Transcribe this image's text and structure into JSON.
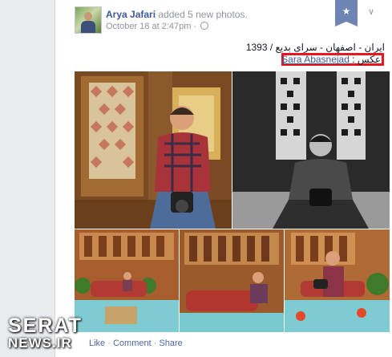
{
  "post": {
    "author": "Arya Jafari",
    "action": " added 5 new photos.",
    "timestamp": "October 18 at 2:47pm",
    "separator": " · ",
    "caption_line1": "ایران - اصفهان - سرای بدیع / 1393",
    "caption_line2_prefix": "عکس : ",
    "caption_line2_name": "Sara Abasnejad"
  },
  "icons": {
    "star": "★",
    "chevron": "∨"
  },
  "actions": {
    "like": "Like",
    "comment": "Comment",
    "share": "Share",
    "dot": " · "
  },
  "watermark": {
    "line1": "SERAT",
    "line2": "NEWS.IR"
  },
  "colors": {
    "link": "#3b5998",
    "highlight_box": "#e8171f",
    "ribbon": "#6d84b4"
  }
}
